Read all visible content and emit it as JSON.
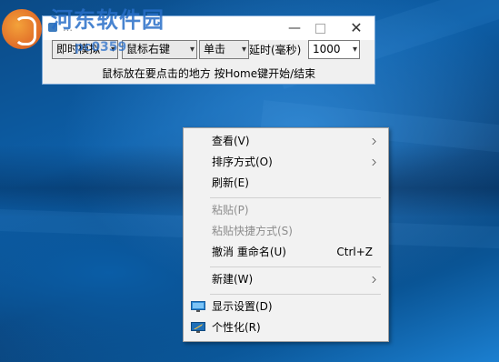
{
  "watermark": {
    "title": "河东软件园",
    "url": "pc0359"
  },
  "app": {
    "title": "…",
    "minimize": "—",
    "close": "✕",
    "controls": {
      "mode": "即时模拟",
      "button": "鼠标右键",
      "click": "单击",
      "delay_label": "延时(毫秒)",
      "delay_value": "1000"
    },
    "hint": "鼠标放在要点击的地方 按Home键开始/结束"
  },
  "context_menu": {
    "items": [
      {
        "label": "查看(V)",
        "submenu": true,
        "enabled": true
      },
      {
        "label": "排序方式(O)",
        "submenu": true,
        "enabled": true
      },
      {
        "label": "刷新(E)",
        "enabled": true
      },
      {
        "label": "粘贴(P)",
        "enabled": false
      },
      {
        "label": "粘贴快捷方式(S)",
        "enabled": false
      },
      {
        "label": "撤消 重命名(U)",
        "shortcut": "Ctrl+Z",
        "enabled": true
      },
      {
        "label": "新建(W)",
        "submenu": true,
        "enabled": true
      },
      {
        "label": "显示设置(D)",
        "icon": "display-settings-icon",
        "enabled": true
      },
      {
        "label": "个性化(R)",
        "icon": "personalize-icon",
        "enabled": true
      }
    ]
  },
  "colors": {
    "desktop": "#0d5fa8",
    "menu_bg": "#f2f2f2",
    "disabled_text": "#8d8d8d"
  }
}
